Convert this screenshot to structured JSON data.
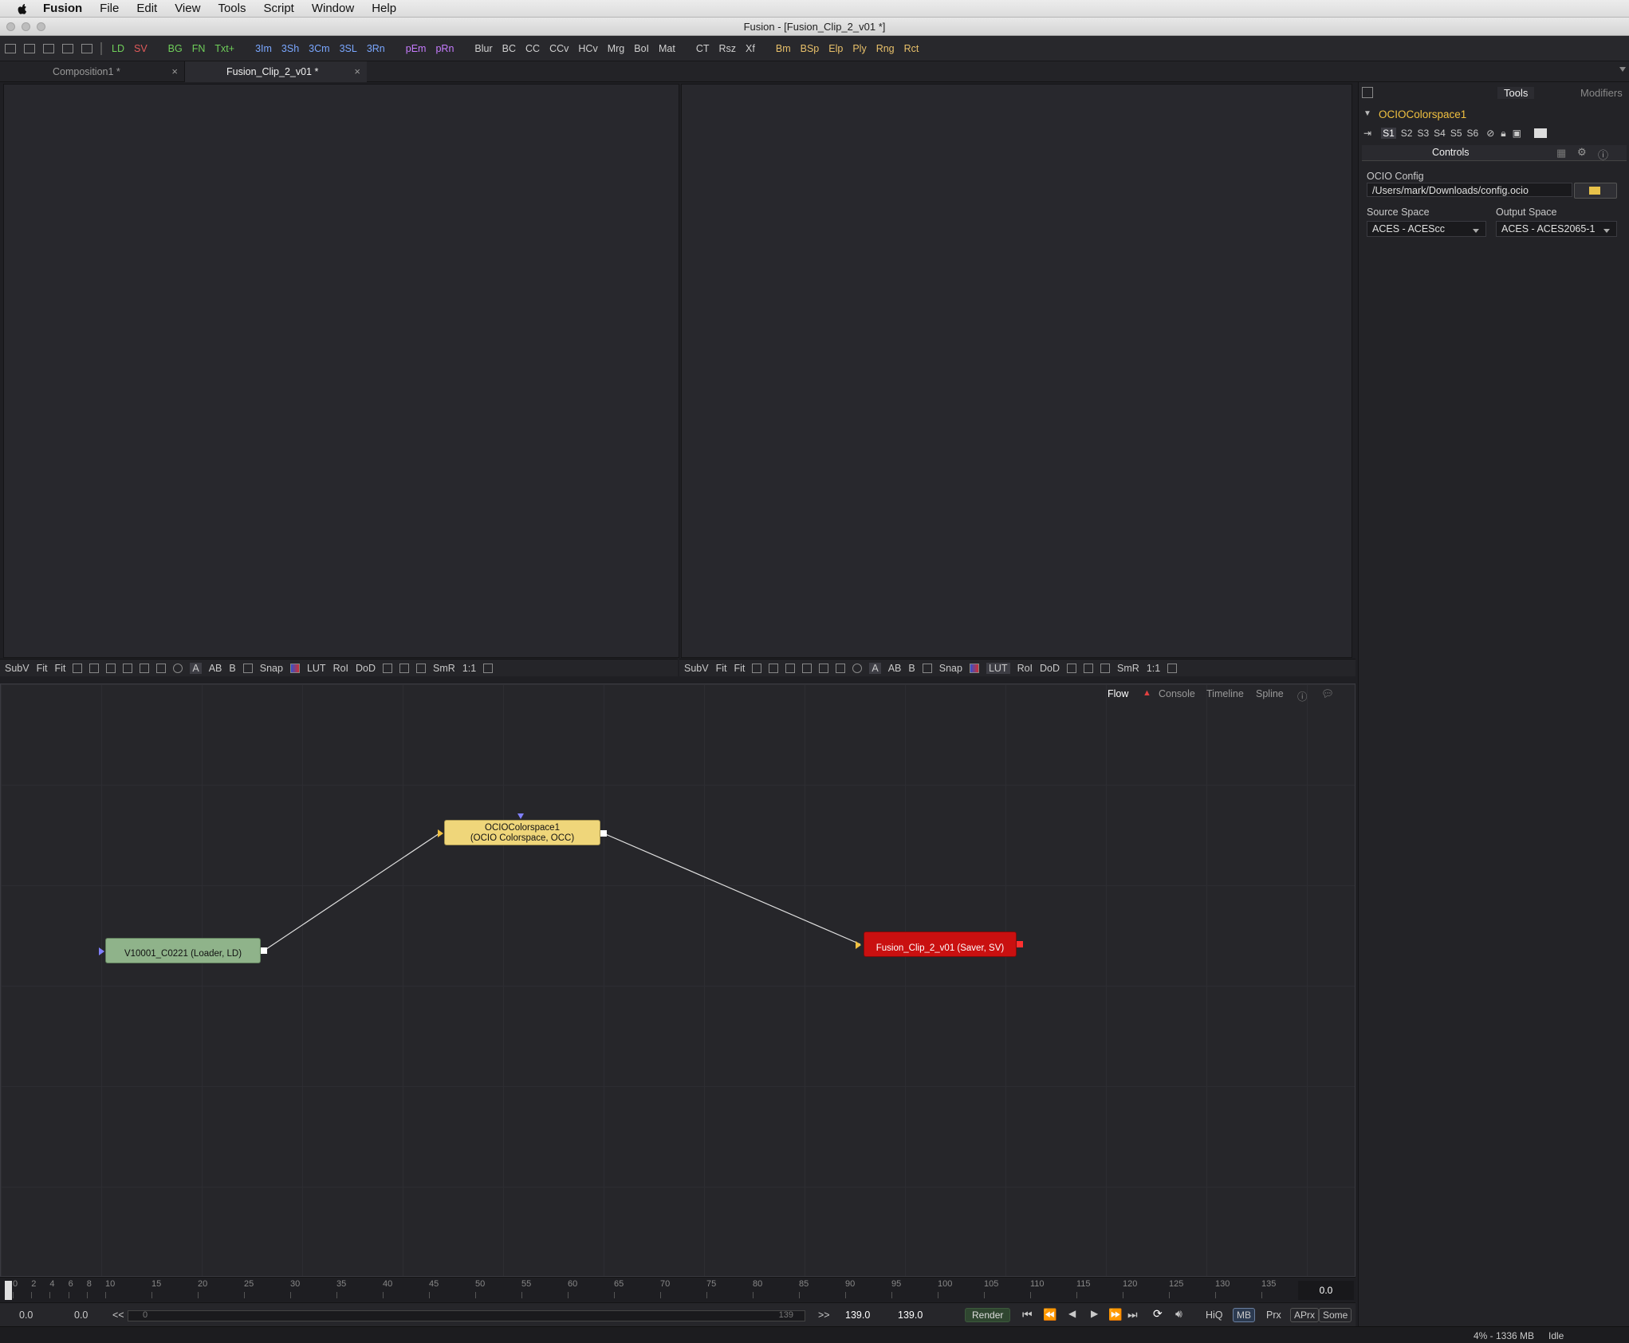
{
  "menubar": {
    "app": "Fusion",
    "items": [
      "File",
      "Edit",
      "View",
      "Tools",
      "Script",
      "Window",
      "Help"
    ]
  },
  "window": {
    "title": "Fusion - [Fusion_Clip_2_v01 *]"
  },
  "toolbar": {
    "tools": [
      {
        "label": "LD",
        "color": "#6fcf5a"
      },
      {
        "label": "SV",
        "color": "#e05a5a"
      },
      {
        "label": "BG",
        "color": "#6fcf5a"
      },
      {
        "label": "FN",
        "color": "#6fcf5a"
      },
      {
        "label": "Txt+",
        "color": "#6fcf5a"
      },
      {
        "label": "3Im",
        "color": "#7aa7ff"
      },
      {
        "label": "3Sh",
        "color": "#7aa7ff"
      },
      {
        "label": "3Cm",
        "color": "#7aa7ff"
      },
      {
        "label": "3SL",
        "color": "#7aa7ff"
      },
      {
        "label": "3Rn",
        "color": "#7aa7ff"
      },
      {
        "label": "pEm",
        "color": "#c77cff"
      },
      {
        "label": "pRn",
        "color": "#c77cff"
      },
      {
        "label": "Blur",
        "color": "#d0d0d0"
      },
      {
        "label": "BC",
        "color": "#d0d0d0"
      },
      {
        "label": "CC",
        "color": "#d0d0d0"
      },
      {
        "label": "CCv",
        "color": "#d0d0d0"
      },
      {
        "label": "HCv",
        "color": "#d0d0d0"
      },
      {
        "label": "Mrg",
        "color": "#d0d0d0"
      },
      {
        "label": "BoI",
        "color": "#d0d0d0"
      },
      {
        "label": "Mat",
        "color": "#d0d0d0"
      },
      {
        "label": "CT",
        "color": "#d0d0d0"
      },
      {
        "label": "Rsz",
        "color": "#d0d0d0"
      },
      {
        "label": "Xf",
        "color": "#d0d0d0"
      },
      {
        "label": "Bm",
        "color": "#e8c06a"
      },
      {
        "label": "BSp",
        "color": "#e8c06a"
      },
      {
        "label": "Elp",
        "color": "#e8c06a"
      },
      {
        "label": "Ply",
        "color": "#e8c06a"
      },
      {
        "label": "Rng",
        "color": "#e8c06a"
      },
      {
        "label": "Rct",
        "color": "#e8c06a"
      }
    ]
  },
  "tabs": [
    {
      "label": "Composition1 *",
      "close": "×"
    },
    {
      "label": "Fusion_Clip_2_v01 *",
      "close": "×"
    }
  ],
  "viewer_bar": {
    "subv": "SubV",
    "fit1": "Fit",
    "fit2": "Fit",
    "a": "A",
    "ab": "AB",
    "b": "B",
    "snap": "Snap",
    "lut": "LUT",
    "roi": "RoI",
    "dod": "DoD",
    "smr": "SmR",
    "ratio": "1:1"
  },
  "inspector": {
    "tab_tools": "Tools",
    "tab_modifiers": "Modifiers",
    "node_name": "OCIOColorspace1",
    "node_name_color": "#f0c040",
    "slots": [
      "S1",
      "S2",
      "S3",
      "S4",
      "S5",
      "S6"
    ],
    "controls_label": "Controls",
    "ocio_config_label": "OCIO Config",
    "ocio_config_value": "/Users/mark/Downloads/config.ocio",
    "source_space_label": "Source Space",
    "source_space_value": "ACES - ACEScc",
    "output_space_label": "Output Space",
    "output_space_value": "ACES - ACES2065-1"
  },
  "flow_tabs": [
    {
      "label": "Flow"
    },
    {
      "label": "Console"
    },
    {
      "label": "Timeline"
    },
    {
      "label": "Spline"
    }
  ],
  "nodes": {
    "loader": {
      "label": "V10001_C0221  (Loader, LD)",
      "color": "#8fb38a"
    },
    "ocio": {
      "line1": "OCIOColorspace1",
      "line2": "(OCIO Colorspace, OCC)",
      "color": "#efd67a"
    },
    "saver": {
      "label": "Fusion_Clip_2_v01  (Saver, SV)",
      "color": "#c91010"
    }
  },
  "timeline": {
    "ticks": [
      "0",
      "2",
      "4",
      "6",
      "8",
      "10",
      "15",
      "20",
      "25",
      "30",
      "35",
      "40",
      "45",
      "50",
      "55",
      "60",
      "65",
      "70",
      "75",
      "80",
      "85",
      "90",
      "95",
      "100",
      "105",
      "110",
      "115",
      "120",
      "125",
      "130",
      "135"
    ],
    "current_time": "0.0"
  },
  "transport": {
    "global_start": "0.0",
    "render_start": "0.0",
    "back": "<<",
    "range_start": "0",
    "range_end": "139",
    "fwd": ">>",
    "render_end": "139.0",
    "global_end": "139.0",
    "render_button": "Render",
    "hiq": "HiQ",
    "mb": "MB",
    "prx": "Prx",
    "aprx": "APrx",
    "some": "Some"
  },
  "status": {
    "memory": "4% - 1336 MB",
    "state": "Idle"
  }
}
